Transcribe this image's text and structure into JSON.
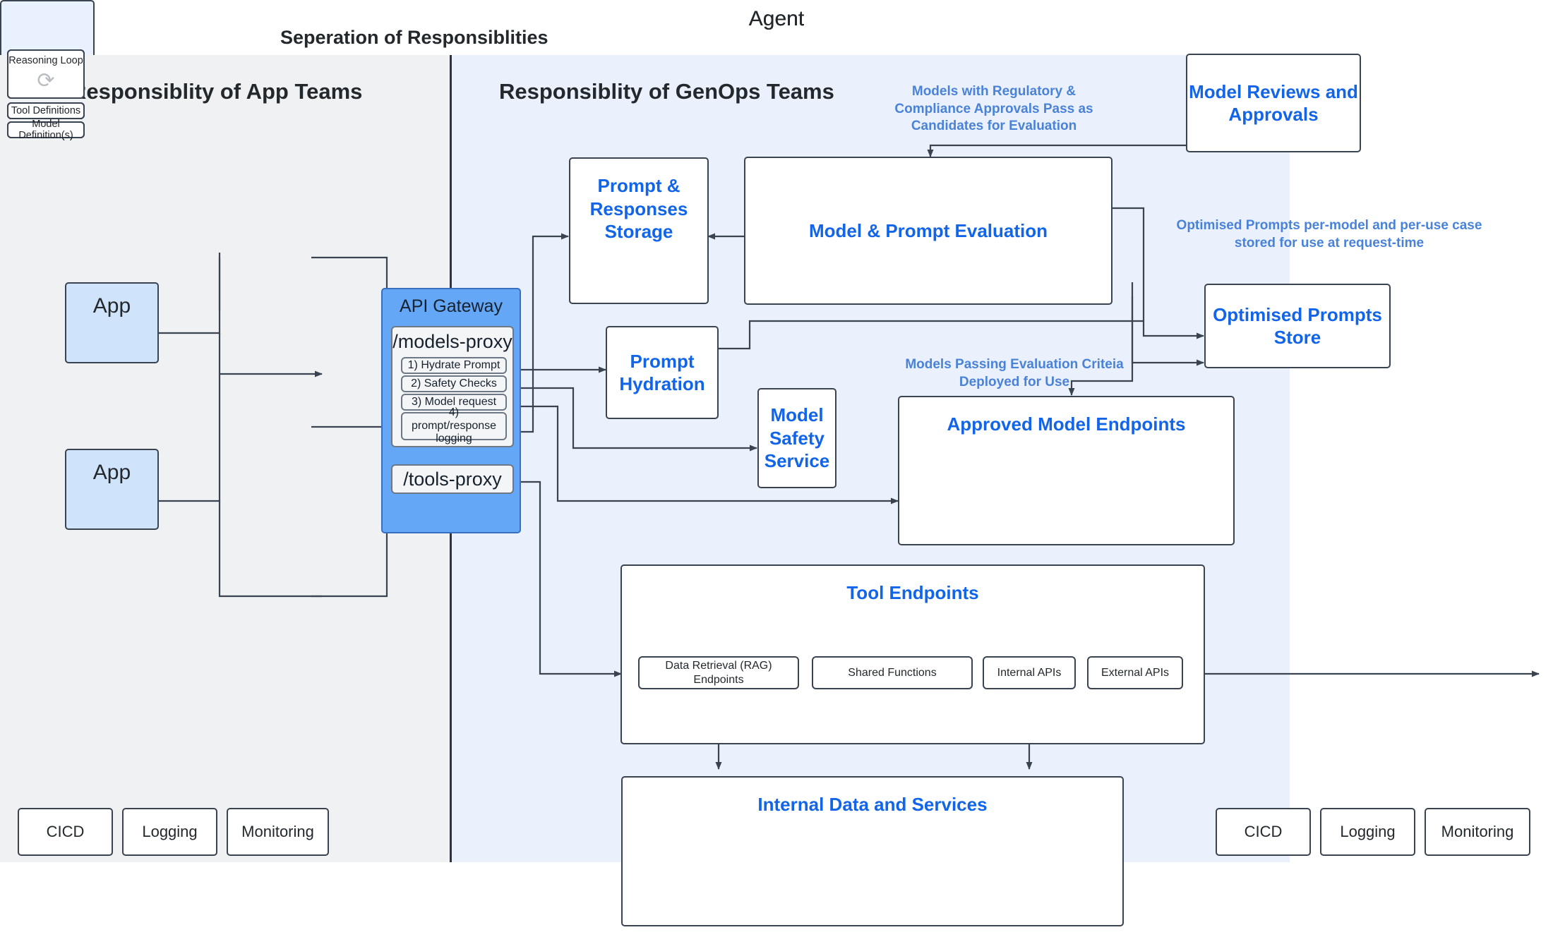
{
  "diagram": {
    "title": "Seperation of Responsiblities",
    "accent_blue": "#1265e8",
    "note_blue": "#4a82d8",
    "app_panel_bg": "#f0f1f2",
    "genops_panel_bg": "#eaf1fd",
    "gateway_bg": "#64a7f7",
    "app_box_bg": "#cfe3fa"
  },
  "panels": {
    "app": {
      "title": "Responsiblity of App Teams"
    },
    "genops": {
      "title": "Responsiblity of GenOps Teams"
    }
  },
  "apps": [
    {
      "label": "App"
    },
    {
      "label": "App"
    }
  ],
  "agents": [
    {
      "title": "Agent",
      "reasoning_loop": "Reasoning Loop",
      "loop_icon": "refresh-cycle-icon",
      "tool_definitions": "Tool Definitions",
      "model_definitions": "Model Definition(s)"
    },
    {
      "title": "Agent",
      "reasoning_loop": "Reasoning Loop",
      "loop_icon": "refresh-cycle-icon",
      "tool_definitions": "Tool Definitions",
      "model_definitions": "Model Definition(s)"
    },
    {
      "title": "Agent",
      "reasoning_loop": "Reasoning Loop",
      "loop_icon": "refresh-cycle-icon",
      "tool_definitions": "Tool Definitions",
      "model_definitions": "Model Definition(s)"
    }
  ],
  "api_gateway": {
    "title": "API Gateway",
    "models_proxy": {
      "title": "/models-proxy",
      "steps": [
        "1) Hydrate Prompt",
        "2) Safety Checks",
        "3) Model request",
        "4) prompt/response logging"
      ]
    },
    "tools_proxy": {
      "title": "/tools-proxy"
    }
  },
  "genops_services": {
    "prompt_responses_storage": "Prompt & Responses Storage",
    "model_prompt_evaluation": "Model & Prompt Evaluation",
    "model_reviews_and_approvals": "Model Reviews and Approvals",
    "optimised_prompts_store": "Optimised Prompts Store",
    "prompt_hydration": "Prompt Hydration",
    "model_safety_service": "Model Safety Service",
    "approved_model_endpoints": "Approved Model Endpoints",
    "tool_endpoints": "Tool Endpoints",
    "internal_data_and_services": "Internal Data and Services"
  },
  "tool_chips": [
    "Data Retrieval (RAG) Endpoints",
    "Shared Functions",
    "Internal APIs",
    "External APIs"
  ],
  "notes": {
    "regulatory": "Models with Regulatory & Compliance Approvals Pass as Candidates for Evaluation",
    "optimised_prompts": "Optimised Prompts per-model and per-use case stored for use at request-time",
    "passing_evaluation": "Models Passing Evaluation Criteia Deployed for Use"
  },
  "ops_left": [
    {
      "label": "CICD"
    },
    {
      "label": "Logging"
    },
    {
      "label": "Monitoring"
    }
  ],
  "ops_right": [
    {
      "label": "CICD"
    },
    {
      "label": "Logging"
    },
    {
      "label": "Monitoring"
    }
  ]
}
